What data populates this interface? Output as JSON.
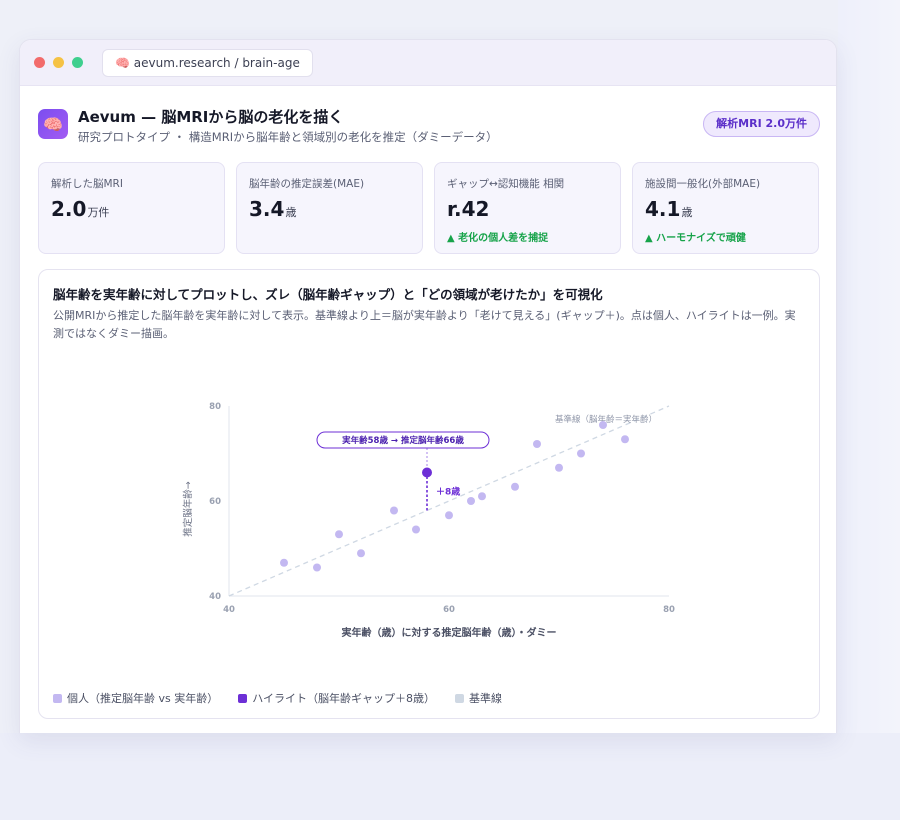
{
  "browser": {
    "url_icon": "🧠",
    "url": "aevum.research / brain-age"
  },
  "header": {
    "logo_icon": "🧠",
    "title": "Aevum — 脳MRIから脳の老化を描く",
    "subtitle": "研究プロトタイプ ・ 構造MRIから脳年齢と領域別の老化を推定（ダミーデータ）",
    "badge": "解析MRI 2.0万件"
  },
  "kpis": [
    {
      "label": "解析した脳MRI",
      "value": "2.0",
      "unit": "万件",
      "trend": ""
    },
    {
      "label": "脳年齢の推定誤差(MAE)",
      "value": "3.4",
      "unit": "歳",
      "trend": ""
    },
    {
      "label": "ギャップ↔認知機能 相関",
      "value": "r.42",
      "unit": "",
      "trend": "▲ 老化の個人差を捕捉"
    },
    {
      "label": "施設間一般化(外部MAE)",
      "value": "4.1",
      "unit": "歳",
      "trend": "▲ ハーモナイズで頑健"
    }
  ],
  "panel": {
    "title": "脳年齢を実年齢に対してプロットし、ズレ（脳年齢ギャップ）と「どの領域が老けたか」を可視化",
    "description": "公開MRIから推定した脳年齢を実年齢に対して表示。基準線より上＝脳が実年齢より「老けて見える」(ギャップ＋)。点は個人、ハイライトは一例。実測ではなくダミー描画。"
  },
  "legend": [
    {
      "label": "個人（推定脳年齢 vs 実年齢）",
      "color": "#c3b8f1"
    },
    {
      "label": "ハイライト（脳年齢ギャップ＋8歳）",
      "color": "#6d2fd6"
    },
    {
      "label": "基準線",
      "color": "#cfd8e3"
    }
  ],
  "chart_data": {
    "type": "scatter",
    "title": "",
    "xlabel": "実年齢（歳）に対する推定脳年齢（歳）・ダミー",
    "ylabel": "推定脳年齢→",
    "xlim": [
      40,
      80
    ],
    "ylim": [
      40,
      80
    ],
    "xticks": [
      "40",
      "60",
      "80"
    ],
    "yticks": [
      "40",
      "60",
      "80"
    ],
    "grid": false,
    "legend_position": "bottom",
    "series": [
      {
        "name": "個人（推定脳年齢 vs 実年齢）",
        "color": "#c3b8f1",
        "points": [
          {
            "x": 45,
            "y": 47
          },
          {
            "x": 48,
            "y": 46
          },
          {
            "x": 50,
            "y": 53
          },
          {
            "x": 52,
            "y": 49
          },
          {
            "x": 55,
            "y": 58
          },
          {
            "x": 57,
            "y": 54
          },
          {
            "x": 60,
            "y": 57
          },
          {
            "x": 62,
            "y": 60
          },
          {
            "x": 63,
            "y": 61
          },
          {
            "x": 66,
            "y": 63
          },
          {
            "x": 68,
            "y": 72
          },
          {
            "x": 70,
            "y": 67
          },
          {
            "x": 72,
            "y": 70
          },
          {
            "x": 74,
            "y": 76
          },
          {
            "x": 76,
            "y": 73
          }
        ]
      },
      {
        "name": "ハイライト（脳年齢ギャップ＋8歳）",
        "color": "#6d2fd6",
        "points": [
          {
            "x": 58,
            "y": 66
          }
        ]
      }
    ],
    "reference_line": {
      "label": "基準線（脳年齢＝実年齢）",
      "from": [
        40,
        40
      ],
      "to": [
        80,
        80
      ],
      "color": "#cfd8e3"
    },
    "annotations": [
      {
        "label": "実年齢58歳 → 推定脳年齢66歳",
        "x": 58,
        "y": 66
      },
      {
        "label": "＋8歳",
        "x": 58,
        "from_y": 58,
        "to_y": 66
      }
    ]
  }
}
